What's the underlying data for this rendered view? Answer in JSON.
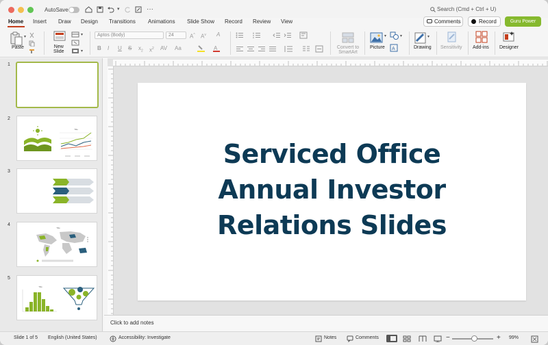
{
  "titlebar": {
    "autosave_label": "AutoSave",
    "more_glyph": "···",
    "search_placeholder": "Search (Cmd + Ctrl + U)"
  },
  "tabs": [
    {
      "label": "Home"
    },
    {
      "label": "Insert"
    },
    {
      "label": "Draw"
    },
    {
      "label": "Design"
    },
    {
      "label": "Transitions"
    },
    {
      "label": "Animations"
    },
    {
      "label": "Slide Show"
    },
    {
      "label": "Record"
    },
    {
      "label": "Review"
    },
    {
      "label": "View"
    }
  ],
  "header_buttons": {
    "comments": "Comments",
    "record": "Record",
    "guru": "Guru Power"
  },
  "ribbon": {
    "paste": "Paste",
    "new_slide": "New\nSlide",
    "font_name": "Aptos (Body)",
    "font_size": "24",
    "convert_smartart": "Convert to\nSmartArt",
    "picture": "Picture",
    "drawing": "Drawing",
    "sensitivity": "Sensitivity",
    "addins": "Add-ins",
    "designer": "Designer"
  },
  "thumbnails": [
    {
      "num": "1"
    },
    {
      "num": "2"
    },
    {
      "num": "3"
    },
    {
      "num": "4"
    },
    {
      "num": "5"
    }
  ],
  "slide": {
    "title_lines": [
      "Serviced Office",
      "Annual Investor",
      "Relations Slides"
    ]
  },
  "notes_placeholder": "Click to add notes",
  "status": {
    "slide_count": "Slide 1 of 5",
    "language": "English (United States)",
    "accessibility": "Accessibility: Investigate",
    "notes": "Notes",
    "comments": "Comments",
    "zoom": "99%"
  },
  "colors": {
    "accent_tab": "#c43e1c",
    "guru_button": "#86b92e",
    "title_text": "#0d3a55",
    "selected_thumb": "#a3b949"
  }
}
